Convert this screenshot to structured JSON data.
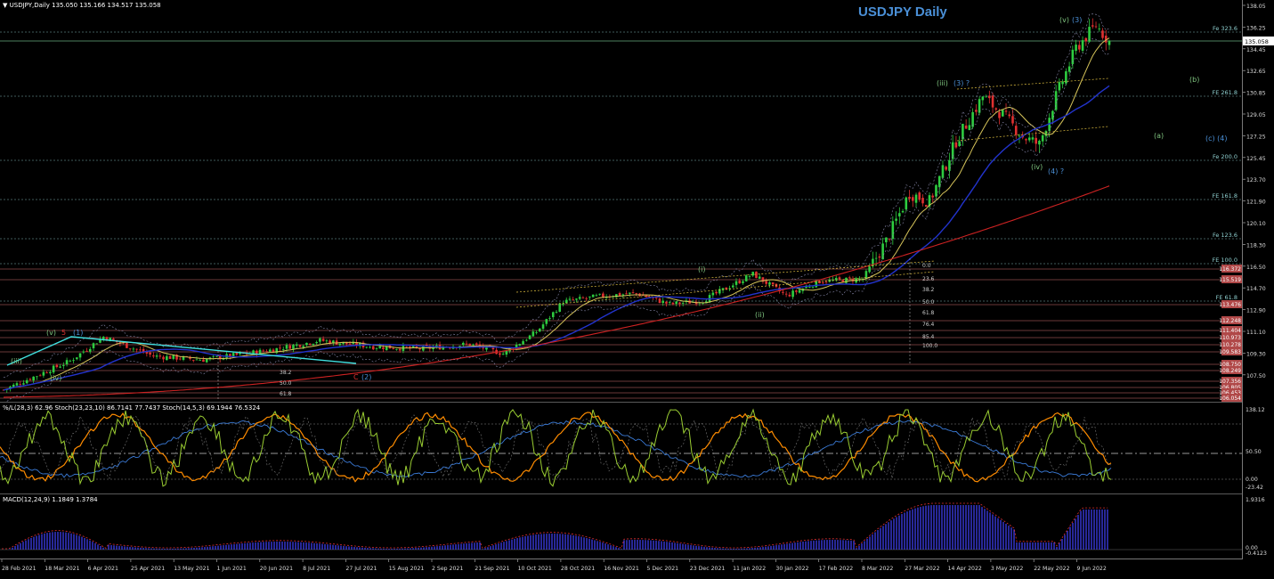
{
  "header": {
    "symbol_line": "USDJPY,Daily  135.050 135.166 134.517 135.058",
    "title": "USDJPY Daily",
    "stoch_line": "%/L(28,3) 62.96  Stoch(23,23,10) 86.7141 77.7437  Stoch(14,5,3) 69.1944 76.5324",
    "macd_line": "MACD(12,24,9) 1.1849 1.3784"
  },
  "price_axis": {
    "ticks": [
      "138.05",
      "136.25",
      "134.45",
      "132.65",
      "130.85",
      "129.05",
      "127.25",
      "125.45",
      "123.70",
      "121.90",
      "120.10",
      "118.30",
      "116.50",
      "114.70",
      "112.90",
      "111.10",
      "109.30",
      "107.50"
    ],
    "current_price": "135.058"
  },
  "hlines": [
    {
      "label": "Fe 323.6"
    },
    {
      "label": "FE 261.8"
    },
    {
      "label": "Fe 200.0"
    },
    {
      "label": "FE 161.8"
    },
    {
      "label": "Fe 123.6"
    },
    {
      "label": "FE 100.0"
    },
    {
      "label": "FE 61.8"
    }
  ],
  "price_tags": [
    "116.372",
    "115.519",
    "113.476",
    "112.248",
    "111.404",
    "110.973",
    "110.278",
    "109.583",
    "108.750",
    "108.249",
    "107.356",
    "106.805",
    "106.453",
    "106.054"
  ],
  "wave_labels": [
    "(iii)",
    "(3) ?",
    "(v)",
    "(3)",
    "(iv)",
    "(4) ?",
    "(b)",
    "(a)",
    "(c) (4)",
    "(i)",
    "(ii)",
    "(2)",
    "C",
    "5",
    "(1)",
    "(v)",
    "(iii)",
    "(iv)"
  ],
  "fib_levels": [
    "0.0",
    "23.6",
    "38.2",
    "50.0",
    "61.8",
    "76.4",
    "85.4",
    "100.0"
  ],
  "fib_levels_lower": [
    "38.2",
    "50.0",
    "61.8"
  ],
  "osc_axis": [
    "138.12",
    "50.50",
    "0.00",
    "-23.42"
  ],
  "macd_axis": [
    "1.9316",
    "0.00",
    "-0.4123"
  ],
  "time_axis": [
    "28 Feb 2021",
    "18 Mar 2021",
    "6 Apr 2021",
    "25 Apr 2021",
    "13 May 2021",
    "1 Jun 2021",
    "20 Jun 2021",
    "8 Jul 2021",
    "27 Jul 2021",
    "15 Aug 2021",
    "2 Sep 2021",
    "21 Sep 2021",
    "10 Oct 2021",
    "28 Oct 2021",
    "16 Nov 2021",
    "5 Dec 2021",
    "23 Dec 2021",
    "11 Jan 2022",
    "30 Jan 2022",
    "17 Feb 2022",
    "8 Mar 2022",
    "27 Mar 2022",
    "14 Apr 2022",
    "3 May 2022",
    "22 May 2022",
    "9 Jun 2022"
  ],
  "colors": {
    "bull": "#2ecc40",
    "bear": "#e03030",
    "ma_yellow": "#d6c45a",
    "ma_blue": "#2233cc",
    "ma_red": "#cc2222",
    "hline": "#7fb3b3",
    "tag": "#ff7070",
    "stoch_green": "#9acd32",
    "stoch_orange": "#ff8c00",
    "macd": "#4444ff"
  }
}
